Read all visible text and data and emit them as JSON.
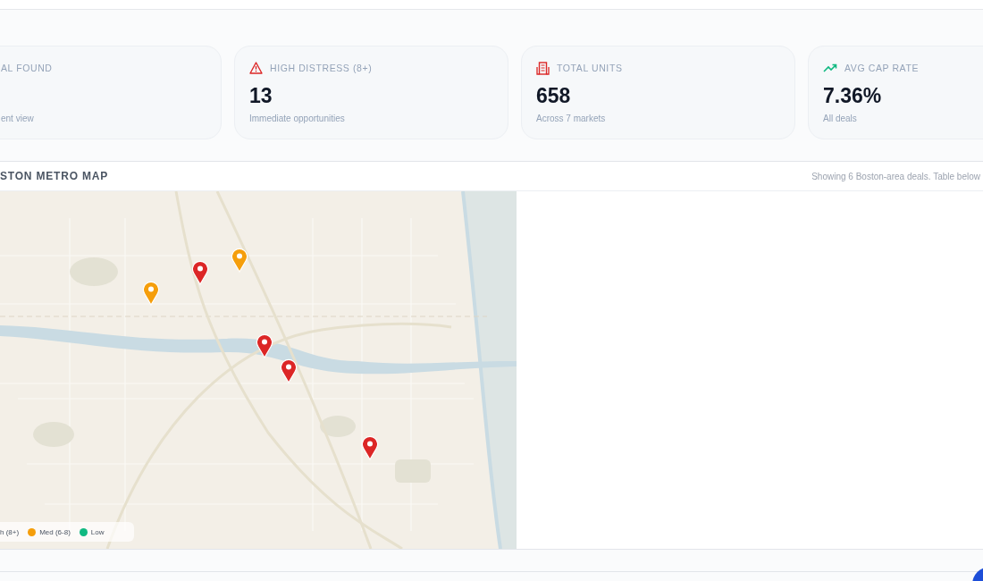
{
  "stats": [
    {
      "label": "AL FOUND",
      "note": "ent view"
    },
    {
      "label": "HIGH DISTRESS (8+)",
      "value": "13",
      "note": "Immediate opportunities"
    },
    {
      "label": "TOTAL UNITS",
      "value": "658",
      "note": "Across 7 markets"
    },
    {
      "label": "AVG CAP RATE",
      "value": "7.36%",
      "note": "All deals"
    }
  ],
  "map_section": {
    "title": "STON METRO MAP",
    "summary": "Showing 6 Boston-area deals. Table below",
    "pins": [
      {
        "color": "#f59e0b"
      },
      {
        "color": "#dc2626"
      },
      {
        "color": "#f59e0b"
      },
      {
        "color": "#dc2626"
      },
      {
        "color": "#dc2626"
      },
      {
        "color": "#dc2626"
      }
    ],
    "legend": [
      {
        "label": "h (8+)"
      },
      {
        "label": "Med (6-8)",
        "color": "#f59e0b"
      },
      {
        "label": "Low",
        "color": "#10b981"
      }
    ]
  }
}
